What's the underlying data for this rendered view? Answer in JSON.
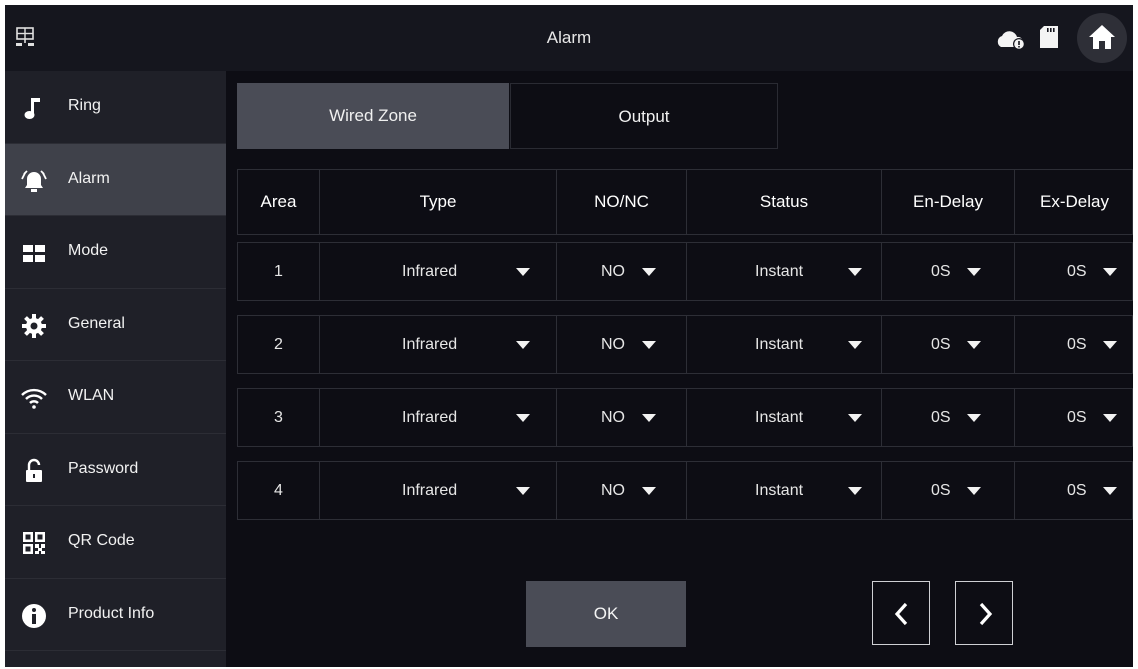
{
  "header": {
    "title": "Alarm",
    "icons": [
      "network-icon",
      "cloud-icon",
      "sd-card-icon",
      "home-icon"
    ]
  },
  "sidebar": {
    "items": [
      {
        "label": "Ring",
        "icon": "music-note-icon"
      },
      {
        "label": "Alarm",
        "icon": "alarm-icon",
        "active": true
      },
      {
        "label": "Mode",
        "icon": "mode-icon"
      },
      {
        "label": "General",
        "icon": "gear-icon"
      },
      {
        "label": "WLAN",
        "icon": "wifi-icon"
      },
      {
        "label": "Password",
        "icon": "lock-icon"
      },
      {
        "label": "QR Code",
        "icon": "qr-code-icon"
      },
      {
        "label": "Product Info",
        "icon": "info-icon"
      }
    ]
  },
  "tabs": {
    "wired_zone": "Wired Zone",
    "output": "Output",
    "active": "Wired Zone"
  },
  "table": {
    "headers": {
      "area": "Area",
      "type": "Type",
      "nonc": "NO/NC",
      "status": "Status",
      "en_delay": "En-Delay",
      "ex_delay": "Ex-Delay"
    },
    "rows": [
      {
        "area": "1",
        "type": "Infrared",
        "nonc": "NO",
        "status": "Instant",
        "en_delay": "0S",
        "ex_delay": "0S"
      },
      {
        "area": "2",
        "type": "Infrared",
        "nonc": "NO",
        "status": "Instant",
        "en_delay": "0S",
        "ex_delay": "0S"
      },
      {
        "area": "3",
        "type": "Infrared",
        "nonc": "NO",
        "status": "Instant",
        "en_delay": "0S",
        "ex_delay": "0S"
      },
      {
        "area": "4",
        "type": "Infrared",
        "nonc": "NO",
        "status": "Instant",
        "en_delay": "0S",
        "ex_delay": "0S"
      }
    ]
  },
  "footer": {
    "ok_label": "OK",
    "prev_icon": "chevron-left-icon",
    "next_icon": "chevron-right-icon"
  },
  "colors": {
    "background": "#0d0d14",
    "topbar": "#15161e",
    "sidebar": "#1f2028",
    "sidebar_active": "#3f414a",
    "button": "#4a4c56"
  }
}
